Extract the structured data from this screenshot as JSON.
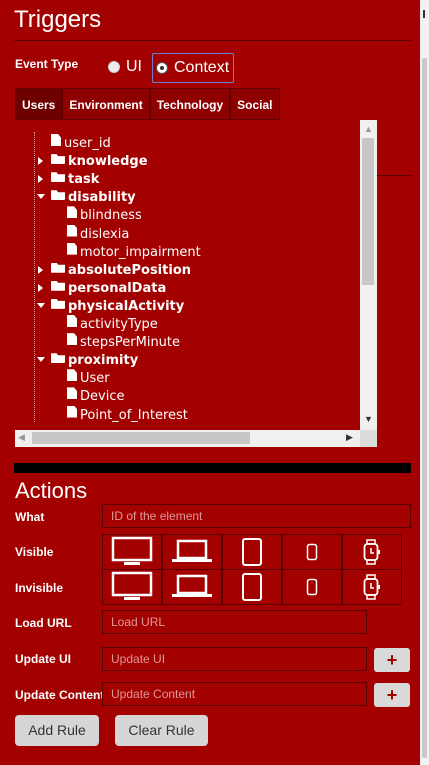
{
  "triggers": {
    "title": "Triggers",
    "event_type": {
      "label": "Event Type",
      "options": [
        {
          "label": "UI",
          "selected": false
        },
        {
          "label": "Context",
          "selected": true
        }
      ]
    },
    "tabs": [
      {
        "label": "Users",
        "active": true
      },
      {
        "label": "Environment",
        "active": false
      },
      {
        "label": "Technology",
        "active": false
      },
      {
        "label": "Social",
        "active": false
      }
    ],
    "tree": [
      {
        "label": "user_id",
        "type": "file",
        "level": 0
      },
      {
        "label": "knowledge",
        "type": "folder",
        "level": 0,
        "expanded": false
      },
      {
        "label": "task",
        "type": "folder",
        "level": 0,
        "expanded": false
      },
      {
        "label": "disability",
        "type": "folder",
        "level": 0,
        "expanded": true
      },
      {
        "label": "blindness",
        "type": "file",
        "level": 1
      },
      {
        "label": "dislexia",
        "type": "file",
        "level": 1
      },
      {
        "label": "motor_impairment",
        "type": "file",
        "level": 1
      },
      {
        "label": "absolutePosition",
        "type": "folder",
        "level": 0,
        "expanded": false
      },
      {
        "label": "personalData",
        "type": "folder",
        "level": 0,
        "expanded": false
      },
      {
        "label": "physicalActivity",
        "type": "folder",
        "level": 0,
        "expanded": true
      },
      {
        "label": "activityType",
        "type": "file",
        "level": 1
      },
      {
        "label": "stepsPerMinute",
        "type": "file",
        "level": 1
      },
      {
        "label": "proximity",
        "type": "folder",
        "level": 0,
        "expanded": true
      },
      {
        "label": "User",
        "type": "file",
        "level": 1
      },
      {
        "label": "Device",
        "type": "file",
        "level": 1
      },
      {
        "label": "Point_of_Interest",
        "type": "file",
        "level": 1
      }
    ]
  },
  "actions": {
    "title": "Actions",
    "what": {
      "label": "What",
      "placeholder": "ID of the element"
    },
    "visible": {
      "label": "Visible",
      "devices": [
        "desktop-icon",
        "laptop-icon",
        "tablet-icon",
        "smartphone-icon",
        "smartwatch-icon"
      ]
    },
    "invisible": {
      "label": "Invisible",
      "devices": [
        "desktop-icon",
        "laptop-icon",
        "tablet-icon",
        "smartphone-icon",
        "smartwatch-icon"
      ]
    },
    "load_url": {
      "label": "Load URL",
      "placeholder": "Load URL"
    },
    "update_ui": {
      "label": "Update UI",
      "placeholder": "Update UI",
      "button": "+"
    },
    "update_content": {
      "label": "Update Content",
      "placeholder": "Update Content",
      "button": "+"
    },
    "add_rule": "Add Rule",
    "clear_rule": "Clear Rule"
  },
  "colors": {
    "panel": "#a30000",
    "border": "#5a0000",
    "button": "#d6d6d6"
  }
}
